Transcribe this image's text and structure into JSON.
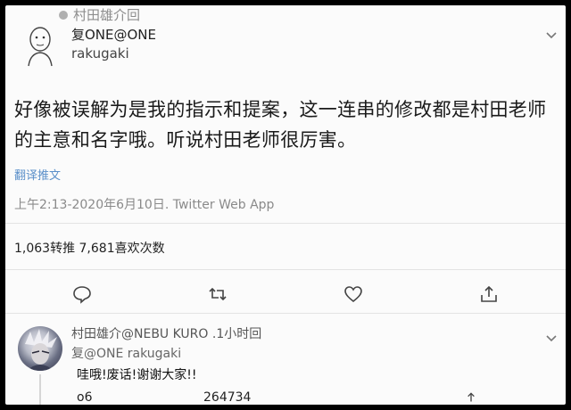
{
  "tweet": {
    "retweeted_by": "村田雄介回",
    "display_name": "复ONE@ONE",
    "handle": "rakugaki",
    "text": "好像被误解为是我的指示和提案，这一连串的修改都是村田老师的主意和名字哦。听说村田老师很厉害。",
    "translate_label": "翻译推文",
    "meta": "上午2:13-2020年6月10日. Twitter Web App",
    "stats": "1,063转推 7,681喜欢次数"
  },
  "actions": {
    "reply_icon": "comment-icon",
    "retweet_icon": "retweet-icon",
    "like_icon": "heart-icon",
    "share_icon": "share-icon"
  },
  "reply": {
    "display_name": "村田雄介@NEBU KURO .1小时回",
    "replying_to": "复@ONE rakugaki",
    "text": "哇哦!废话!谢谢大家!!",
    "count_a": "o6",
    "count_b": "264734"
  },
  "colors": {
    "link": "#5a8fc9",
    "text": "#1a1a1a",
    "muted": "#8a8a8a"
  }
}
